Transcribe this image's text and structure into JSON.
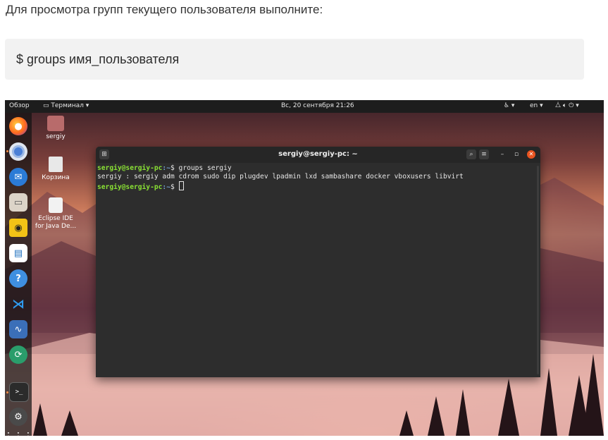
{
  "article": {
    "intro": "Для просмотра групп текущего пользователя выполните:",
    "code": "$ groups имя_пользователя"
  },
  "topbar": {
    "overview": "Обзор",
    "app_menu": "Терминал ▾",
    "datetime": "Вс, 20 сентября  21:26",
    "accessibility": "♿ ▾",
    "language": "en ▾"
  },
  "desktop": {
    "icons": [
      {
        "label": "sergiy"
      },
      {
        "label": "Корзина"
      },
      {
        "label": "Eclipse IDE for Java De..."
      }
    ]
  },
  "dock": {
    "apps": [
      "firefox-icon",
      "chromium-icon",
      "thunderbird-icon",
      "files-icon",
      "rhythmbox-icon",
      "writer-icon",
      "help-icon",
      "vscode-icon",
      "system-monitor-icon",
      "software-icon",
      "terminal-icon",
      "settings-icon",
      "show-apps-icon"
    ]
  },
  "terminal": {
    "title": "sergiy@sergiy-pc: ~",
    "prompt_user": "sergiy@sergiy-pc",
    "prompt_path": ":~",
    "prompt_symbol": "$ ",
    "command": "groups sergiy",
    "output": "sergiy : sergiy adm cdrom sudo dip plugdev lpadmin lxd sambashare docker vboxusers libvirt",
    "minimize": "–",
    "maximize": "▫",
    "close": "✕"
  }
}
